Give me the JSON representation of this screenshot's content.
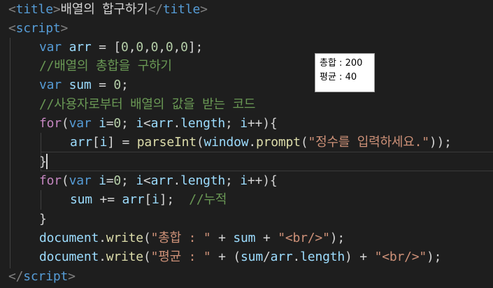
{
  "code": {
    "l1": {
      "open_tag_a": "<",
      "open_tag_name": "title",
      "open_tag_b": ">",
      "text": "배열의 합구하기",
      "close_tag_a": "</",
      "close_tag_name": "title",
      "close_tag_b": ">"
    },
    "l2": {
      "a": "<",
      "name": "script",
      "b": ">"
    },
    "l3": {
      "kw": "var",
      "id": "arr",
      "rest": " = [",
      "n1": "0",
      "c1": ",",
      "n2": "0",
      "c2": ",",
      "n3": "0",
      "c3": ",",
      "n4": "0",
      "c4": ",",
      "n5": "0",
      "end": "];"
    },
    "l4": {
      "comment": "//배열의 총합을 구하기"
    },
    "l5": {
      "kw": "var",
      "id": "sum",
      "rest": " = ",
      "num": "0",
      "end": ";"
    },
    "l6": {
      "comment": "//사용자로부터 배열의 값을 받는 코드"
    },
    "l7": {
      "ctrl": "for",
      "p1": "(",
      "kw": "var",
      "id1": "i",
      "eq": "=",
      "n0": "0",
      "s1": "; ",
      "id2": "i",
      "lt": "<",
      "id3": "arr",
      "dot": ".",
      "id4": "length",
      "s2": "; ",
      "id5": "i",
      "inc": "++){"
    },
    "l8": {
      "id1": "arr",
      "b1": "[",
      "id2": "i",
      "b2": "]",
      "eq": " = ",
      "fn1": "parseInt",
      "p1": "(",
      "id3": "window",
      "dot": ".",
      "fn2": "prompt",
      "p2": "(",
      "str": "\"정수를 입력하세요.\"",
      "end": "));"
    },
    "l9": {
      "brace": "}"
    },
    "l10": {
      "ctrl": "for",
      "p1": "(",
      "kw": "var",
      "id1": "i",
      "eq": "=",
      "n0": "0",
      "s1": "; ",
      "id2": "i",
      "lt": "<",
      "id3": "arr",
      "dot": ".",
      "id4": "length",
      "s2": "; ",
      "id5": "i",
      "inc": "++){"
    },
    "l11": {
      "id1": "sum",
      "op": " += ",
      "id2": "arr",
      "b1": "[",
      "id3": "i",
      "b2": "];  ",
      "comment": "//누적"
    },
    "l12": {
      "brace": "}"
    },
    "l13": {
      "id": "document",
      "dot": ".",
      "fn": "write",
      "p1": "(",
      "str1": "\"총합 : \"",
      "plus1": " + ",
      "id2": "sum",
      "plus2": " + ",
      "str2": "\"<br/>\"",
      "end": ");"
    },
    "l14": {
      "id": "document",
      "dot": ".",
      "fn": "write",
      "p1": "(",
      "str1": "\"평균 : \"",
      "plus1": " + (",
      "id2": "sum",
      "slash": "/",
      "id3": "arr",
      "dot2": ".",
      "id4": "length",
      "plus2": ") + ",
      "str2": "\"<br/>\"",
      "end": ");"
    },
    "l15": {
      "a": "</",
      "name": "script",
      "b": ">"
    }
  },
  "popup": {
    "sum_label": "총합 : 200",
    "avg_label": "평균 : 40"
  }
}
